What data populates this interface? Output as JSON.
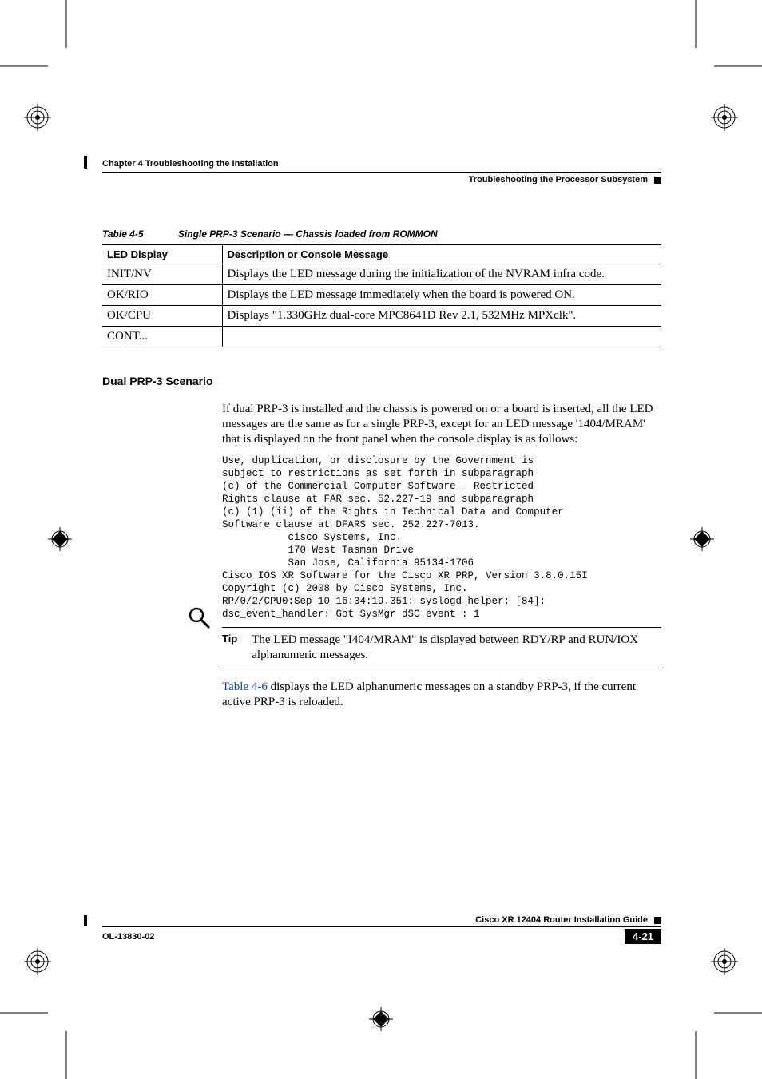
{
  "header": {
    "chapter": "Chapter 4      Troubleshooting the Installation",
    "section": "Troubleshooting the Processor Subsystem"
  },
  "table": {
    "caption_num": "Table 4-5",
    "caption_title": "Single PRP-3 Scenario  —  Chassis loaded from ROMMON",
    "head_col1": "LED Display",
    "head_col2": "Description or Console Message",
    "rows": [
      {
        "c1": "INIT/NV",
        "c2": "Displays the LED message during the initialization of the NVRAM infra code."
      },
      {
        "c1": "OK/RIO",
        "c2": "Displays the LED message immediately when the board is powered ON."
      },
      {
        "c1": "OK/CPU",
        "c2": "Displays \"1.330GHz dual-core MPC8641D Rev 2.1, 532MHz MPXclk\"."
      },
      {
        "c1": "CONT...",
        "c2": ""
      }
    ]
  },
  "subhead": "Dual PRP-3 Scenario",
  "para1": "If dual PRP-3 is installed and the chassis is powered on or a board is inserted, all the LED messages are the same as for a single PRP-3, except for an LED message '1404/MRAM' that is displayed on the front panel when the console display is as follows:",
  "console": "Use, duplication, or disclosure by the Government is\nsubject to restrictions as set forth in subparagraph\n(c) of the Commercial Computer Software - Restricted\nRights clause at FAR sec. 52.227-19 and subparagraph\n(c) (1) (ii) of the Rights in Technical Data and Computer\nSoftware clause at DFARS sec. 252.227-7013.\n           cisco Systems, Inc.\n           170 West Tasman Drive\n           San Jose, California 95134-1706\nCisco IOS XR Software for the Cisco XR PRP, Version 3.8.0.15I\nCopyright (c) 2008 by Cisco Systems, Inc.\nRP/0/2/CPU0:Sep 10 16:34:19.351: syslogd_helper: [84]:\ndsc_event_handler: Got SysMgr dSC event : 1",
  "tip": {
    "label": "Tip",
    "text": "The LED message \"I404/MRAM\" is displayed between RDY/RP and RUN/IOX alphanumeric messages."
  },
  "para2_pre": "",
  "para2_link": "Table 4-6",
  "para2_post": " displays the LED alphanumeric messages on a standby PRP-3, if the current active PRP-3 is reloaded.",
  "footer": {
    "guide": "Cisco XR 12404 Router Installation Guide",
    "doc": "OL-13830-02",
    "page": "4-21"
  }
}
